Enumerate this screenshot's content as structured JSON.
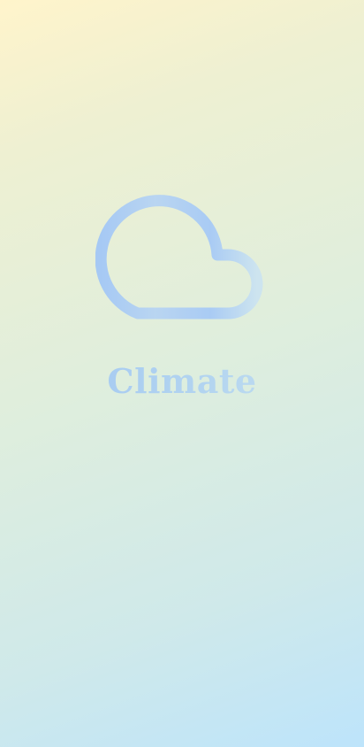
{
  "splash": {
    "app_name": "Climate",
    "logo_icon": "cloud-icon"
  },
  "colors": {
    "background_top": "#fff4cb",
    "background_bottom": "#bde4fb",
    "accent_light": "#cde5ef",
    "accent": "#9ec4f3"
  }
}
